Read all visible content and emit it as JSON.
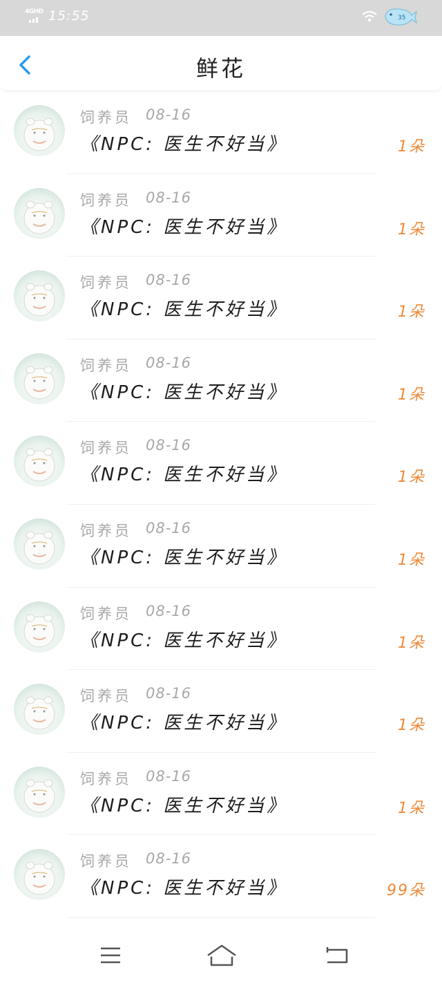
{
  "status_bar": {
    "network": "4GHD",
    "time": "15:55",
    "battery_level": "35",
    "icons": [
      "signal-icon",
      "wifi-icon",
      "battery-icon"
    ]
  },
  "header": {
    "title": "鲜花",
    "back_icon": "chevron-left-icon"
  },
  "records": [
    {
      "user": "饲养员",
      "date": "08-16",
      "book": "《NPC: 医生不好当》",
      "count": "1朵"
    },
    {
      "user": "饲养员",
      "date": "08-16",
      "book": "《NPC: 医生不好当》",
      "count": "1朵"
    },
    {
      "user": "饲养员",
      "date": "08-16",
      "book": "《NPC: 医生不好当》",
      "count": "1朵"
    },
    {
      "user": "饲养员",
      "date": "08-16",
      "book": "《NPC: 医生不好当》",
      "count": "1朵"
    },
    {
      "user": "饲养员",
      "date": "08-16",
      "book": "《NPC: 医生不好当》",
      "count": "1朵"
    },
    {
      "user": "饲养员",
      "date": "08-16",
      "book": "《NPC: 医生不好当》",
      "count": "1朵"
    },
    {
      "user": "饲养员",
      "date": "08-16",
      "book": "《NPC: 医生不好当》",
      "count": "1朵"
    },
    {
      "user": "饲养员",
      "date": "08-16",
      "book": "《NPC: 医生不好当》",
      "count": "1朵"
    },
    {
      "user": "饲养员",
      "date": "08-16",
      "book": "《NPC: 医生不好当》",
      "count": "1朵"
    },
    {
      "user": "饲养员",
      "date": "08-16",
      "book": "《NPC: 医生不好当》",
      "count": "99朵"
    }
  ],
  "colors": {
    "accent_blue": "#2a9be8",
    "count_orange": "#ee8a3a",
    "status_bar_bg": "#d8d8d8"
  },
  "nav_bar": {
    "icons": [
      "menu-icon",
      "home-icon",
      "back-icon"
    ]
  }
}
